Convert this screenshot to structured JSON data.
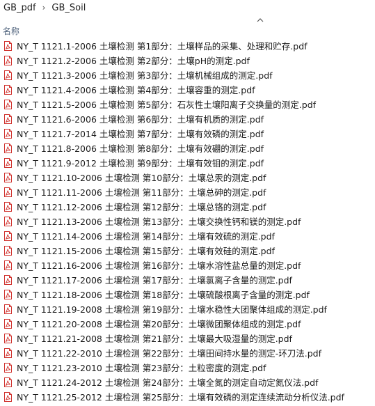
{
  "breadcrumb": {
    "items": [
      "GB_pdf",
      "GB_Soil"
    ],
    "separator": "›"
  },
  "column_header": {
    "name_label": "名称",
    "sort_icon": "chevron-up-icon"
  },
  "colors": {
    "pdf_icon_red": "#d0312d",
    "header_text": "#4c607a"
  },
  "files": [
    "NY_T 1121.1-2006 土壤检测 第1部分：土壤样品的采集、处理和贮存.pdf",
    "NY_T 1121.2-2006 土壤检测 第2部分：土壤pH的测定.pdf",
    "NY_T 1121.3-2006 土壤检测 第3部分：土壤机械组成的测定.pdf",
    "NY_T 1121.4-2006 土壤检测 第4部分：土壤容重的测定.pdf",
    "NY_T 1121.5-2006 土壤检测 第5部分：石灰性土壤阳离子交换量的测定.pdf",
    "NY_T 1121.6-2006 土壤检测 第6部分：土壤有机质的测定.pdf",
    "NY_T 1121.7-2014 土壤检测 第7部分：土壤有效磷的测定.pdf",
    "NY_T 1121.8-2006 土壤检测 第8部分：土壤有效硼的测定.pdf",
    "NY_T 1121.9-2012 土壤检测 第9部分：土壤有效钼的测定.pdf",
    "NY_T 1121.10-2006 土壤检测 第10部分：土壤总汞的测定.pdf",
    "NY_T 1121.11-2006 土壤检测 第11部分：土壤总砷的测定.pdf",
    "NY_T 1121.12-2006 土壤检测 第12部分：土壤总铬的测定.pdf",
    "NY_T 1121.13-2006 土壤检测 第13部分：土壤交换性钙和镁的测定.pdf",
    "NY_T 1121.14-2006 土壤检测 第14部分：土壤有效硫的测定.pdf",
    "NY_T 1121.15-2006 土壤检测 第15部分：土壤有效硅的测定.pdf",
    "NY_T 1121.16-2006 土壤检测 第16部分：土壤水溶性盐总量的测定.pdf",
    "NY_T 1121.17-2006 土壤检测 第17部分：土壤氯离子含量的测定.pdf",
    "NY_T 1121.18-2006 土壤检测 第18部分：土壤硫酸根离子含量的测定.pdf",
    "NY_T 1121.19-2008 土壤检测 第19部分：土壤水稳性大团聚体组成的测定.pdf",
    "NY_T 1121.20-2008 土壤检测 第20部分：土壤微团聚体组成的测定.pdf",
    "NY_T 1121.21-2008 土壤检测 第21部分：土壤最大吸湿量的测定.pdf",
    "NY_T 1121.22-2010 土壤检测 第22部分：土壤田间持水量的测定-环刀法.pdf",
    "NY_T 1121.23-2010 土壤检测 第23部分：土粒密度的测定.pdf",
    "NY_T 1121.24-2012 土壤检测 第24部分：土壤全氮的测定自动定氮仪法.pdf",
    "NY_T 1121.25-2012 土壤检测 第25部分：土壤有效磷的测定连续流动分析仪法.pdf"
  ]
}
